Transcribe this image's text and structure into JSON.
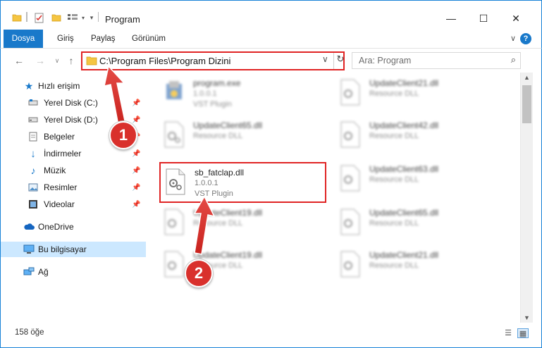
{
  "window": {
    "title": "Program",
    "minimize": "—",
    "maximize": "☐",
    "close": "✕"
  },
  "ribbon": {
    "tabs": [
      "Dosya",
      "Giriş",
      "Paylaş",
      "Görünüm"
    ],
    "help": "?"
  },
  "nav": {
    "address_path": "C:\\Program Files\\Program Dizini",
    "search_placeholder": "Ara: Program"
  },
  "sidebar": {
    "quick_access": "Hızlı erişim",
    "items": [
      {
        "label": "Yerel Disk (C:)",
        "icon": "drive-icon"
      },
      {
        "label": "Yerel Disk (D:)",
        "icon": "drive-icon"
      },
      {
        "label": "Belgeler",
        "icon": "documents-icon"
      },
      {
        "label": "İndirmeler",
        "icon": "downloads-icon"
      },
      {
        "label": "Müzik",
        "icon": "music-icon"
      },
      {
        "label": "Resimler",
        "icon": "pictures-icon"
      },
      {
        "label": "Videolar",
        "icon": "videos-icon"
      }
    ],
    "onedrive": "OneDrive",
    "this_pc": "Bu bilgisayar",
    "network": "Ağ"
  },
  "files": {
    "left": [
      {
        "name": "program.exe",
        "version": "1.0.0.1",
        "desc": "VST Plugin"
      },
      {
        "name": "UpdateClient65.dll",
        "version": "",
        "desc": "Resource DLL"
      },
      {
        "name": "sb_fatclap.dll",
        "version": "1.0.0.1",
        "desc": "VST Plugin"
      },
      {
        "name": "UpdateClient19.dll",
        "version": "",
        "desc": "Resource DLL"
      },
      {
        "name": "UpdateClient19.dll",
        "version": "",
        "desc": "Resource DLL"
      }
    ],
    "right": [
      {
        "name": "UpdateClient21.dll",
        "version": "",
        "desc": "Resource DLL"
      },
      {
        "name": "UpdateClient42.dll",
        "version": "",
        "desc": "Resource DLL"
      },
      {
        "name": "UpdateClient63.dll",
        "version": "",
        "desc": "Resource DLL"
      },
      {
        "name": "UpdateClient65.dll",
        "version": "",
        "desc": "Resource DLL"
      },
      {
        "name": "UpdateClient21.dll",
        "version": "",
        "desc": "Resource DLL"
      }
    ]
  },
  "status": {
    "item_count": "158 öğe"
  },
  "annotations": {
    "step1": "1",
    "step2": "2",
    "highlight_color": "#e02424",
    "badge_color": "#d9302c"
  }
}
